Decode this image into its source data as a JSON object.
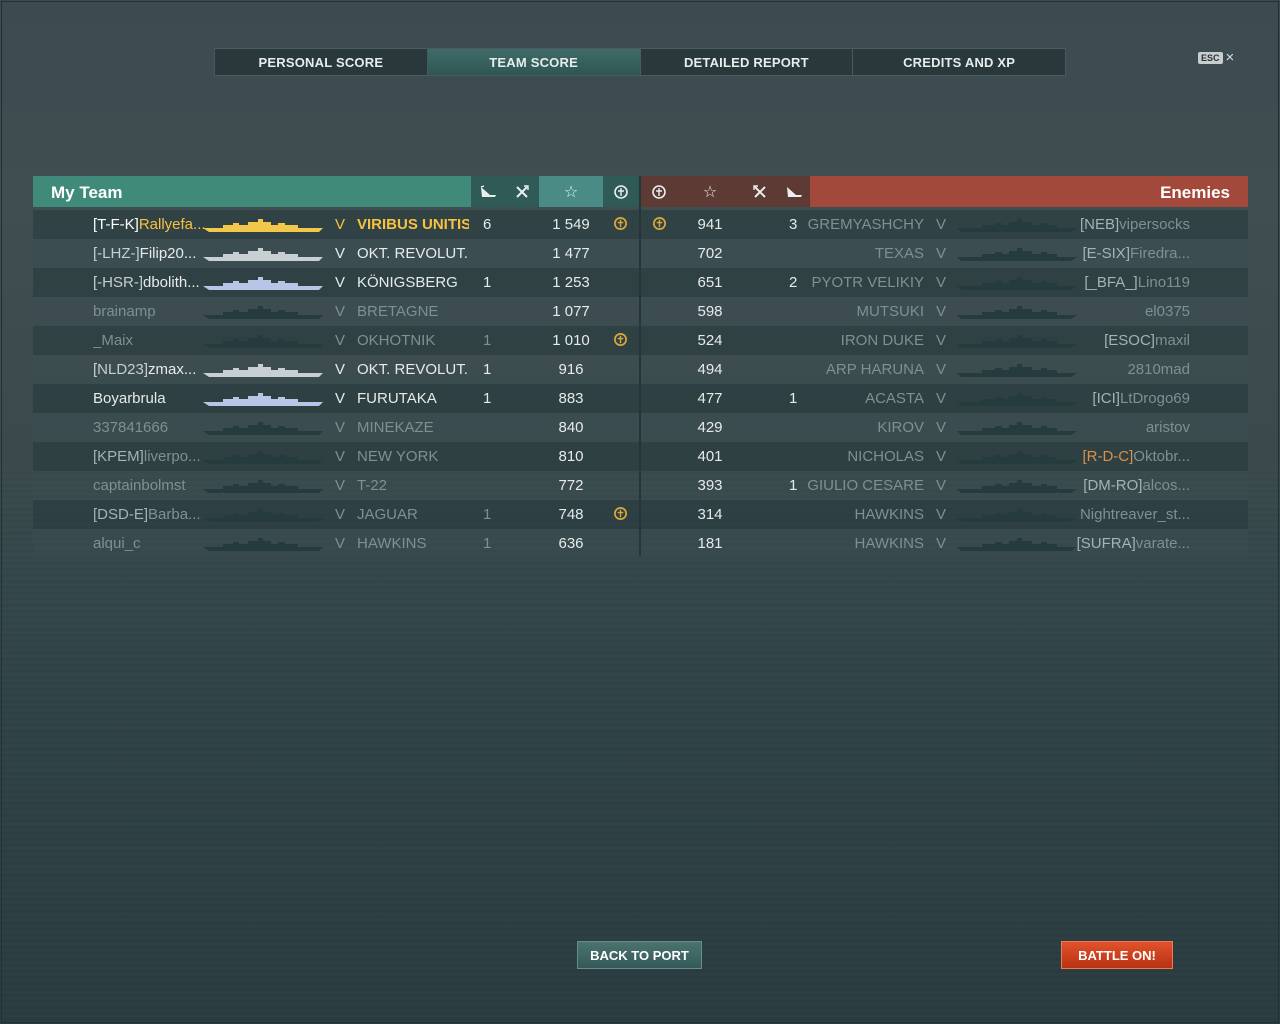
{
  "tabs": [
    {
      "label": "PERSONAL SCORE",
      "active": false
    },
    {
      "label": "TEAM SCORE",
      "active": true
    },
    {
      "label": "DETAILED REPORT",
      "active": false
    },
    {
      "label": "CREDITS AND XP",
      "active": false
    }
  ],
  "esc_label": "ESC",
  "my_team": {
    "title": "My Team",
    "rows": [
      {
        "clan": "[T-F-K]",
        "name": "Rallyefa...",
        "tier": "V",
        "ship": "VIRIBUS UNITIS",
        "kills": "6",
        "score": "1 549",
        "medal": true,
        "style": "self"
      },
      {
        "clan": "[-LHZ-]",
        "name": "Filip20...",
        "tier": "V",
        "ship": "OKT. REVOLUT...",
        "kills": "",
        "score": "1 477",
        "medal": false,
        "style": "alive"
      },
      {
        "clan": "[-HSR-]",
        "name": "dbolith...",
        "tier": "V",
        "ship": "KÖNIGSBERG",
        "kills": "1",
        "score": "1 253",
        "medal": false,
        "style": "alive"
      },
      {
        "clan": "",
        "name": "brainamp",
        "tier": "V",
        "ship": "BRETAGNE",
        "kills": "",
        "score": "1 077",
        "medal": false,
        "style": "dead"
      },
      {
        "clan": "",
        "name": "_Maix",
        "tier": "V",
        "ship": "OKHOTNIK",
        "kills": "1",
        "score": "1 010",
        "medal": true,
        "style": "dead"
      },
      {
        "clan": "[NLD23]",
        "name": "zmax...",
        "tier": "V",
        "ship": "OKT. REVOLUT...",
        "kills": "1",
        "score": "916",
        "medal": false,
        "style": "alive"
      },
      {
        "clan": "",
        "name": "Boyarbrula",
        "tier": "V",
        "ship": "FURUTAKA",
        "kills": "1",
        "score": "883",
        "medal": false,
        "style": "alive"
      },
      {
        "clan": "",
        "name": "337841666",
        "tier": "V",
        "ship": "MINEKAZE",
        "kills": "",
        "score": "840",
        "medal": false,
        "style": "dead"
      },
      {
        "clan": "[KPEM]",
        "name": "liverpo...",
        "tier": "V",
        "ship": "NEW YORK",
        "kills": "",
        "score": "810",
        "medal": false,
        "style": "dead"
      },
      {
        "clan": "",
        "name": "captainbolmst",
        "tier": "V",
        "ship": "T-22",
        "kills": "",
        "score": "772",
        "medal": false,
        "style": "dead"
      },
      {
        "clan": "[DSD-E]",
        "name": "Barba...",
        "tier": "V",
        "ship": "JAGUAR",
        "kills": "1",
        "score": "748",
        "medal": true,
        "style": "dead"
      },
      {
        "clan": "",
        "name": "alqui_c",
        "tier": "V",
        "ship": "HAWKINS",
        "kills": "1",
        "score": "636",
        "medal": false,
        "style": "dead"
      }
    ]
  },
  "enemies": {
    "title": "Enemies",
    "rows": [
      {
        "medal": true,
        "score": "941",
        "kills": "3",
        "ship": "GREMYASHCHY",
        "tier": "V",
        "clan": "[NEB]",
        "name": "vipersocks",
        "clan_color": "grey"
      },
      {
        "medal": false,
        "score": "702",
        "kills": "",
        "ship": "TEXAS",
        "tier": "V",
        "clan": "[E-SIX]",
        "name": "Firedra...",
        "clan_color": "grey"
      },
      {
        "medal": false,
        "score": "651",
        "kills": "2",
        "ship": "PYOTR VELIKIY",
        "tier": "V",
        "clan": "[_BFA_]",
        "name": "Lino119",
        "clan_color": "grey"
      },
      {
        "medal": false,
        "score": "598",
        "kills": "",
        "ship": "MUTSUKI",
        "tier": "V",
        "clan": "",
        "name": "el0375",
        "clan_color": "grey"
      },
      {
        "medal": false,
        "score": "524",
        "kills": "",
        "ship": "IRON DUKE",
        "tier": "V",
        "clan": "[ESOC]",
        "name": "maxil",
        "clan_color": "grey"
      },
      {
        "medal": false,
        "score": "494",
        "kills": "",
        "ship": "ARP HARUNA",
        "tier": "V",
        "clan": "",
        "name": "2810mad",
        "clan_color": "grey"
      },
      {
        "medal": false,
        "score": "477",
        "kills": "1",
        "ship": "ACASTA",
        "tier": "V",
        "clan": "[ICI]",
        "name": "LtDrogo69",
        "clan_color": "grey"
      },
      {
        "medal": false,
        "score": "429",
        "kills": "",
        "ship": "KIROV",
        "tier": "V",
        "clan": "",
        "name": "aristov",
        "clan_color": "grey"
      },
      {
        "medal": false,
        "score": "401",
        "kills": "",
        "ship": "NICHOLAS",
        "tier": "V",
        "clan": "[R-D-C]",
        "name": "Oktobr...",
        "clan_color": "orange"
      },
      {
        "medal": false,
        "score": "393",
        "kills": "1",
        "ship": "GIULIO CESARE",
        "tier": "V",
        "clan": "[DM-RO]",
        "name": "alcos...",
        "clan_color": "grey"
      },
      {
        "medal": false,
        "score": "314",
        "kills": "",
        "ship": "HAWKINS",
        "tier": "V",
        "clan": "",
        "name": "Nightreaver_st...",
        "clan_color": "grey"
      },
      {
        "medal": false,
        "score": "181",
        "kills": "",
        "ship": "HAWKINS",
        "tier": "V",
        "clan": "[SUFRA]",
        "name": "varate...",
        "clan_color": "grey"
      }
    ]
  },
  "buttons": {
    "back": "BACK TO PORT",
    "battle": "BATTLE ON!"
  },
  "colors": {
    "self": "#f5c242",
    "alive": "#e6ebea",
    "dead": "#7e9090",
    "dead_clan": "#a4b3b3",
    "orange_clan": "#d8914a",
    "my_header": "#3f8a78",
    "enemy_header": "#a2493b",
    "ship_self": "#f2c84a",
    "ship_alive": "#c7cfd3",
    "ship_blue": "#b9c5e6",
    "ship_dead": "#263b3e"
  }
}
